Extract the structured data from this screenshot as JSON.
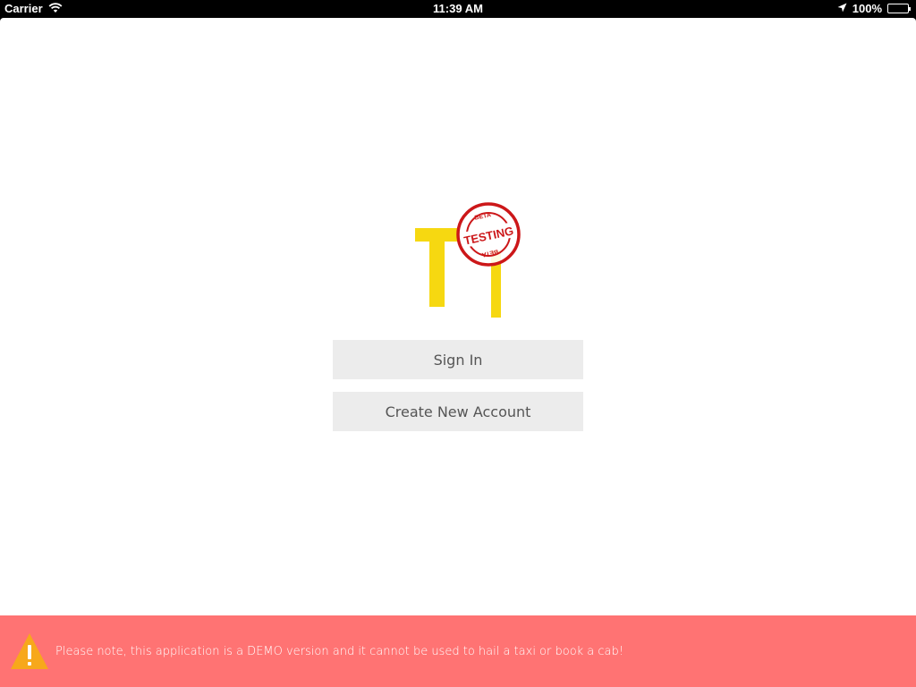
{
  "status_bar": {
    "carrier": "Carrier",
    "time": "11:39 AM",
    "battery": "100%",
    "icons": [
      "wifi-icon",
      "location-arrow-icon",
      "battery-icon"
    ]
  },
  "logo": {
    "letters": "TI",
    "badge_top": "BETA",
    "badge_center": "TESTING",
    "badge_bottom": "BETA",
    "colors": {
      "logo_yellow": "#f6d811",
      "badge_red": "#cc1719"
    }
  },
  "buttons": {
    "sign_in": "Sign In",
    "create_account": "Create New Account"
  },
  "banner": {
    "icon": "warning-icon",
    "message": "Please note, this application is a DEMO version and it cannot be used to hail a taxi or book a cab!",
    "background": "#ff7373"
  }
}
